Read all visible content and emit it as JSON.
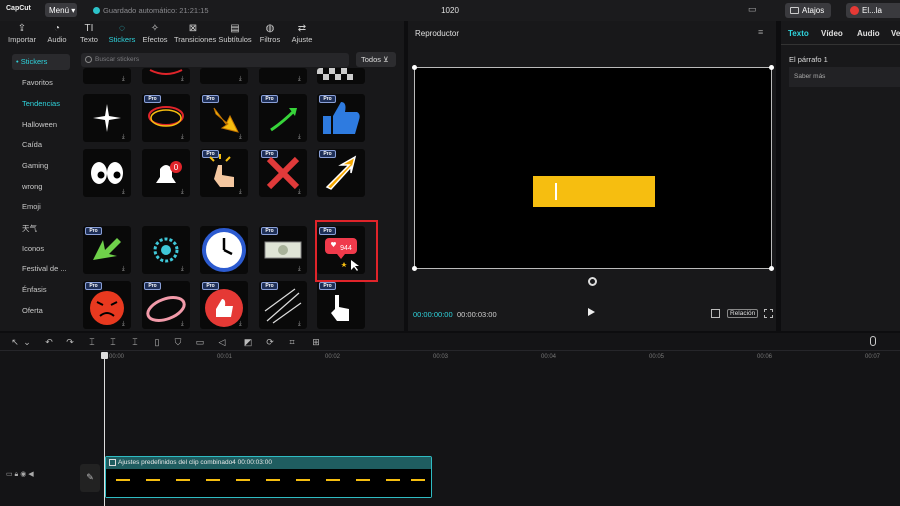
{
  "app": {
    "logo": "CapCut",
    "menu_label": "Menú",
    "autosave": "Guardado automático: 21:21:15",
    "project_title": "1020",
    "shortcuts_label": "Atajos",
    "user_label": "El...la"
  },
  "toolbar": {
    "tools": [
      {
        "label": "Importar",
        "icon": "import-icon"
      },
      {
        "label": "Audio",
        "icon": "audio-icon"
      },
      {
        "label": "Texto",
        "icon": "text-icon"
      },
      {
        "label": "Stickers",
        "icon": "stickers-icon",
        "active": true
      },
      {
        "label": "Efectos",
        "icon": "effects-icon"
      },
      {
        "label": "Transiciones",
        "icon": "transitions-icon"
      },
      {
        "label": "Subtítulos",
        "icon": "subtitles-icon"
      },
      {
        "label": "Filtros",
        "icon": "filters-icon"
      },
      {
        "label": "Ajuste",
        "icon": "adjust-icon"
      }
    ]
  },
  "stickers": {
    "categories": [
      "• Stickers",
      "Favoritos",
      "Tendencias",
      "Halloween",
      "Caída",
      "Gaming",
      "wrong",
      "Emoji",
      "天气",
      "Iconos",
      "Festival de ...",
      "Énfasis",
      "Oferta"
    ],
    "search_placeholder": "Buscar stickers",
    "filter_label": "Todos",
    "pro_badge": "Pro",
    "like_count": "944"
  },
  "player": {
    "title": "Reproductor",
    "time_current": "00:00:00:00",
    "time_total": "00:00:03:00",
    "ratio_label": "Relación"
  },
  "inspector": {
    "tabs": [
      "Texto",
      "Vídeo",
      "Audio",
      "Ve"
    ],
    "paragraph_label": "El párrafo 1",
    "learn_more": "Saber más"
  },
  "timeline": {
    "ruler": [
      "00:00",
      "00:01",
      "00:02",
      "00:03",
      "00:04",
      "00:05",
      "00:06",
      "00:07"
    ],
    "clip_label": "Ajustes predefinidos del clip combinado4",
    "clip_duration": "00:00:03:00"
  },
  "colors": {
    "accent": "#2fd3dc",
    "highlight": "#e0242a",
    "text_bar": "#f6be10"
  }
}
